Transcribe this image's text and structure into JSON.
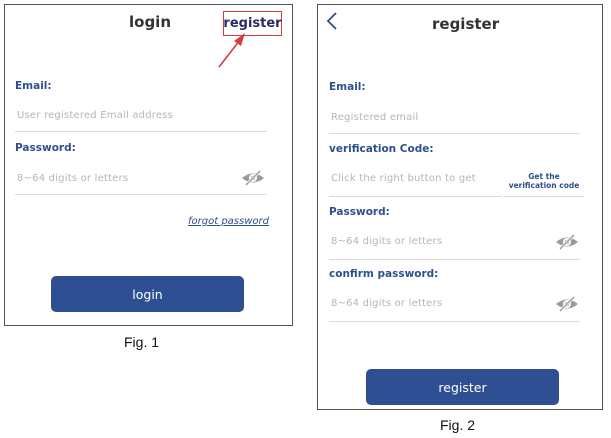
{
  "fig1": {
    "title": "login",
    "register_link": "register",
    "email_label": "Email:",
    "email_placeholder": "User registered Email address",
    "password_label": "Password:",
    "password_placeholder": "8~64 digits or letters",
    "forgot_password": "forgot password",
    "login_button": "login",
    "caption": "Fig. 1"
  },
  "fig2": {
    "back_icon": "chevron-left-icon",
    "title": "register",
    "email_label": "Email:",
    "email_placeholder": "Registered email",
    "code_label": "verification Code:",
    "code_placeholder": "Click the right button to get",
    "get_code_button": "Get the verification code",
    "password_label": "Password:",
    "password_placeholder": "8~64 digits or letters",
    "confirm_label": "confirm password:",
    "confirm_placeholder": "8~64 digits or letters",
    "register_button": "register",
    "caption": "Fig. 2"
  },
  "colors": {
    "accent": "#2f4f93",
    "label": "#2e4f8e",
    "highlight": "#d93b3b"
  }
}
